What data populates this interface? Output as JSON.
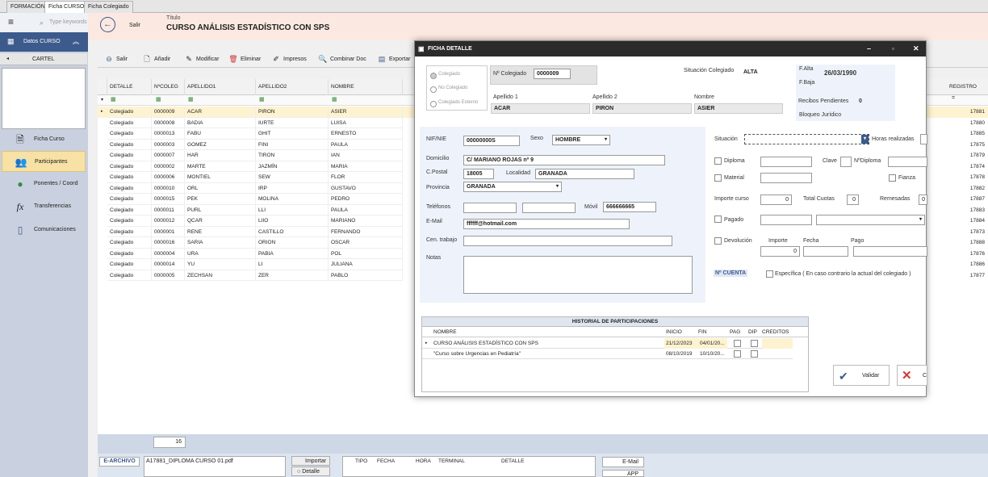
{
  "tabs": [
    "FORMACIÓN",
    "Ficha CURSO",
    "Ficha Colegiado"
  ],
  "search": {
    "placeholder": "Type keywords"
  },
  "header": {
    "exit_label": "Salir",
    "title_label": "Título",
    "title": "CURSO ANÁLISIS ESTADÍSTICO CON SPS"
  },
  "sidebar": {
    "title": "Datos CURSO",
    "cartel": "CARTEL",
    "items": [
      {
        "label": "Ficha Curso",
        "icon": "document-icon"
      },
      {
        "label": "Participantes",
        "icon": "users-icon"
      },
      {
        "label": "Ponentes / Coord",
        "icon": "person-icon"
      },
      {
        "label": "Transferencias",
        "icon": "function-icon"
      },
      {
        "label": "Comunicaciones",
        "icon": "phone-icon"
      }
    ]
  },
  "toolbar": {
    "salir": "Salir",
    "anadir": "Añadir",
    "modificar": "Modificar",
    "eliminar": "Eliminar",
    "impresos": "Impresos",
    "combinar": "Combinar Doc",
    "exportar": "Exportar"
  },
  "grid": {
    "columns": [
      "DETALLE",
      "NºCOLEG",
      "APELLIDO1",
      "APELLIDO2",
      "NOMBRE"
    ],
    "registro_col": "REGISTRO",
    "rows": [
      [
        "Colegiado",
        "0000009",
        "ACAR",
        "PIRON",
        "ASIER",
        "17881"
      ],
      [
        "Colegiado",
        "0000008",
        "BADIA",
        "IURTE",
        "LUISA",
        "17880"
      ],
      [
        "Colegiado",
        "0000013",
        "FABU",
        "GHIT",
        "ERNESTO",
        "17885"
      ],
      [
        "Colegiado",
        "0000003",
        "GOMEZ",
        "FINI",
        "PAULA",
        "17875"
      ],
      [
        "Colegiado",
        "0000007",
        "HAR",
        "TIRON",
        "IAN",
        "17879"
      ],
      [
        "Colegiado",
        "0000002",
        "MARTE",
        "JAZMÍN",
        "MARIA",
        "17874"
      ],
      [
        "Colegiado",
        "0000006",
        "MONTIEL",
        "SEW",
        "FLOR",
        "17878"
      ],
      [
        "Colegiado",
        "0000010",
        "ORL",
        "IRP",
        "GUSTAVO",
        "17882"
      ],
      [
        "Colegiado",
        "0000015",
        "PEK",
        "MOLINA",
        "PEDRO",
        "17887"
      ],
      [
        "Colegiado",
        "0000011",
        "PURL",
        "LLI",
        "PAULA",
        "17883"
      ],
      [
        "Colegiado",
        "0000012",
        "QCAR",
        "LIIO",
        "MARIANO",
        "17884"
      ],
      [
        "Colegiado",
        "0000001",
        "RENE",
        "CASTILLO",
        "FERNANDO",
        "17873"
      ],
      [
        "Colegiado",
        "0000016",
        "SARIA",
        "ORION",
        "OSCAR",
        "17888"
      ],
      [
        "Colegiado",
        "0000004",
        "URA",
        "PABIA",
        "POL",
        "17876"
      ],
      [
        "Colegiado",
        "0000014",
        "YU",
        "LI",
        "JULIANA",
        "17886"
      ],
      [
        "Colegiado",
        "0000005",
        "ZECHSAN",
        "ZER",
        "PABLO",
        "17877"
      ]
    ],
    "count": "16"
  },
  "bottom": {
    "earchivo": "E-ARCHIVO",
    "file": "A17881_DIPLOMA CURSO 01.pdf",
    "importar": "Importar",
    "detalle": "Detalle",
    "cols": [
      "TIPO",
      "FECHA",
      "HORA",
      "TERMINAL",
      "DETALLE"
    ],
    "email": "E-Mail",
    "app": "APP"
  },
  "dialog": {
    "title": "FICHA DETALLE",
    "radios": [
      "Colegiado",
      "No Colegiado",
      "Colegiado Externo"
    ],
    "ncol_label": "Nº Colegiado",
    "ncol": "0000009",
    "situacion_col_label": "Situación Colegiado",
    "situacion_col": "ALTA",
    "falta_label": "F.Alta",
    "falta": "26/03/1990",
    "fbaja_label": "F.Baja",
    "ap1_label": "Apellido 1",
    "ap1": "ACAR",
    "ap2_label": "Apellido 2",
    "ap2": "PIRON",
    "nombre_label": "Nombre",
    "nombre": "ASIER",
    "recibos_label": "Recibos Pendientes",
    "recibos": "0",
    "bloqueo_label": "Bloqueo Jurídico",
    "nif_label": "NIF/NIE",
    "nif": "00000000S",
    "sexo_label": "Sexo",
    "sexo": "HOMBRE",
    "domicilio_label": "Domicilio",
    "domicilio": "C/ MARIANO ROJAS nº 9",
    "cp_label": "C.Postal",
    "cp": "18005",
    "localidad_label": "Localidad",
    "localidad": "GRANADA",
    "provincia_label": "Provincia",
    "provincia": "GRANADA",
    "telefonos_label": "Teléfonos",
    "movil_label": "Móvil",
    "movil": "666666665",
    "email_label": "E-Mail",
    "email": "ffffff@hotmail.com",
    "cen_label": "Cen. trabajo",
    "notas_label": "Notas",
    "situacion_label": "Situación",
    "horas_label": "Horas realizadas",
    "diploma_label": "Diploma",
    "clave_label": "Clave",
    "ndiploma_label": "NºDiploma",
    "material_label": "Material",
    "fianza_label": "Fianza",
    "importe_curso_label": "Importe curso",
    "importe_curso": "0",
    "total_cuotas_label": "Total Cuotas",
    "total_cuotas": "0",
    "remesadas_label": "Remesadas",
    "remesadas": "0",
    "pagado_label": "Pagado",
    "devolucion_label": "Devolución",
    "importe_label": "Importe",
    "importe": "0",
    "fecha_label": "Fecha",
    "pago_label": "Pago",
    "ncuenta_label": "Nº CUENTA",
    "especifica_label": "Específica ( En caso contrario la actual del colegiado )",
    "historial": {
      "title": "HISTORIAL DE PARTICIPACIONES",
      "cols": [
        "NOMBRE",
        "INICIO",
        "FIN",
        "PAG",
        "DIP",
        "CREDITOS"
      ],
      "rows": [
        [
          "CURSO ANÁLISIS ESTADÍSTICO CON SPS",
          "21/12/2023",
          "04/01/20..."
        ],
        [
          "\"Curso sobre Urgencias en Pediatría\"",
          "08/10/2019",
          "10/10/20..."
        ]
      ]
    },
    "validar": "Validar",
    "cancelar": "C"
  }
}
